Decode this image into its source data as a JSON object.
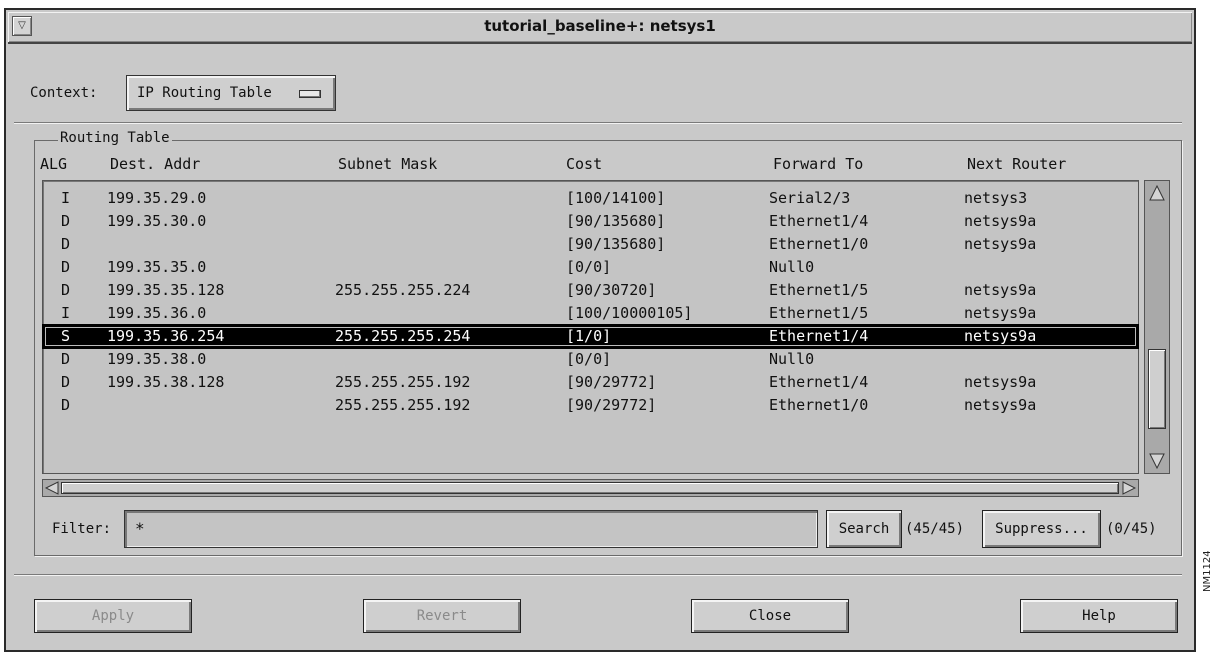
{
  "window": {
    "title": "tutorial_baseline+: netsys1",
    "menu_glyph": "▽"
  },
  "context": {
    "label": "Context:",
    "value": "IP Routing Table"
  },
  "routing_table": {
    "group_label": "Routing Table",
    "columns": [
      "ALG",
      "Dest. Addr",
      "Subnet Mask",
      "Cost",
      "Forward To",
      "Next Router"
    ],
    "rows": [
      {
        "alg": "I",
        "dest": "199.35.29.0",
        "mask": "",
        "cost": "[100/14100]",
        "forward": "Serial2/3",
        "next": "netsys3"
      },
      {
        "alg": "D",
        "dest": "199.35.30.0",
        "mask": "",
        "cost": "[90/135680]",
        "forward": "Ethernet1/4",
        "next": "netsys9a"
      },
      {
        "alg": "D",
        "dest": "",
        "mask": "",
        "cost": "[90/135680]",
        "forward": "Ethernet1/0",
        "next": "netsys9a"
      },
      {
        "alg": "D",
        "dest": "199.35.35.0",
        "mask": "",
        "cost": "[0/0]",
        "forward": "Null0",
        "next": ""
      },
      {
        "alg": "D",
        "dest": "199.35.35.128",
        "mask": "255.255.255.224",
        "cost": "[90/30720]",
        "forward": "Ethernet1/5",
        "next": "netsys9a"
      },
      {
        "alg": "I",
        "dest": "199.35.36.0",
        "mask": "",
        "cost": "[100/10000105]",
        "forward": "Ethernet1/5",
        "next": "netsys9a"
      },
      {
        "alg": "S",
        "dest": "199.35.36.254",
        "mask": "255.255.255.254",
        "cost": "[1/0]",
        "forward": "Ethernet1/4",
        "next": "netsys9a",
        "selected": true
      },
      {
        "alg": "D",
        "dest": "199.35.38.0",
        "mask": "",
        "cost": "[0/0]",
        "forward": "Null0",
        "next": ""
      },
      {
        "alg": "D",
        "dest": "199.35.38.128",
        "mask": "255.255.255.192",
        "cost": "[90/29772]",
        "forward": "Ethernet1/4",
        "next": "netsys9a"
      },
      {
        "alg": "D",
        "dest": "",
        "mask": "255.255.255.192",
        "cost": "[90/29772]",
        "forward": "Ethernet1/0",
        "next": "netsys9a"
      }
    ]
  },
  "filter": {
    "label": "Filter:",
    "value": "*",
    "search_label": "Search",
    "search_count": "(45/45)",
    "suppress_label": "Suppress...",
    "suppress_count": "(0/45)"
  },
  "buttons": {
    "apply": "Apply",
    "revert": "Revert",
    "close": "Close",
    "help": "Help"
  },
  "side_label": "NM1124"
}
